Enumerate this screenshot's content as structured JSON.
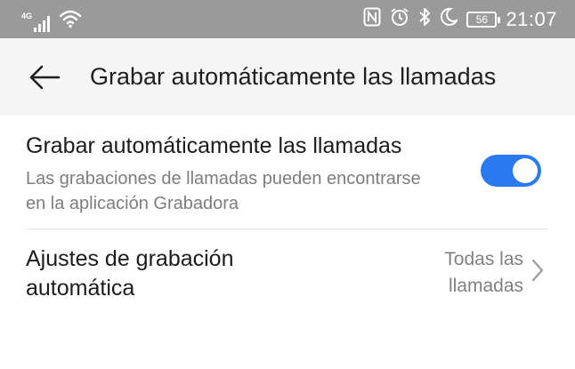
{
  "status_bar": {
    "network_type": "4G",
    "time": "21:07",
    "battery_level": "56",
    "icons": [
      "signal-icon",
      "wifi-icon",
      "nfc-icon",
      "alarm-icon",
      "bluetooth-icon",
      "do-not-disturb-icon",
      "battery-icon"
    ]
  },
  "toolbar": {
    "back_icon": "arrow-left-icon",
    "title": "Grabar automáticamente las llamadas"
  },
  "settings": {
    "auto_record": {
      "title": "Grabar automáticamente las llamadas",
      "description": "Las grabaciones de llamadas pueden encontrarse en la aplicación Grabadora",
      "enabled": true
    },
    "auto_record_settings": {
      "title": "Ajustes de grabación automática",
      "value": "Todas las llamadas",
      "chevron_icon": "chevron-right-icon"
    }
  },
  "colors": {
    "status_bar": "#9a9a9a",
    "toolbar": "#f5f5f5",
    "accent": "#2b79f0"
  }
}
